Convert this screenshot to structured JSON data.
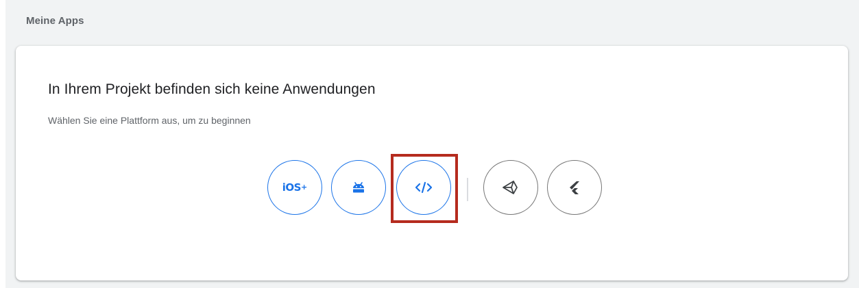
{
  "section": {
    "title": "Meine Apps"
  },
  "card": {
    "title": "In Ihrem Projekt befinden sich keine Anwendungen",
    "subtitle": "Wählen Sie eine Plattform aus, um zu beginnen"
  },
  "platforms": [
    {
      "id": "ios",
      "label": "iOS",
      "suffix": "+",
      "icon": "ios-plus-icon",
      "color": "#1a73e8"
    },
    {
      "id": "android",
      "icon": "android-icon",
      "color": "#1a73e8"
    },
    {
      "id": "web",
      "icon": "web-code-icon",
      "color": "#1a73e8",
      "highlighted": true
    },
    {
      "id": "unity",
      "icon": "unity-icon",
      "color": "#757575"
    },
    {
      "id": "flutter",
      "icon": "flutter-icon",
      "color": "#757575"
    }
  ],
  "highlight": {
    "color": "#b52b1e"
  }
}
